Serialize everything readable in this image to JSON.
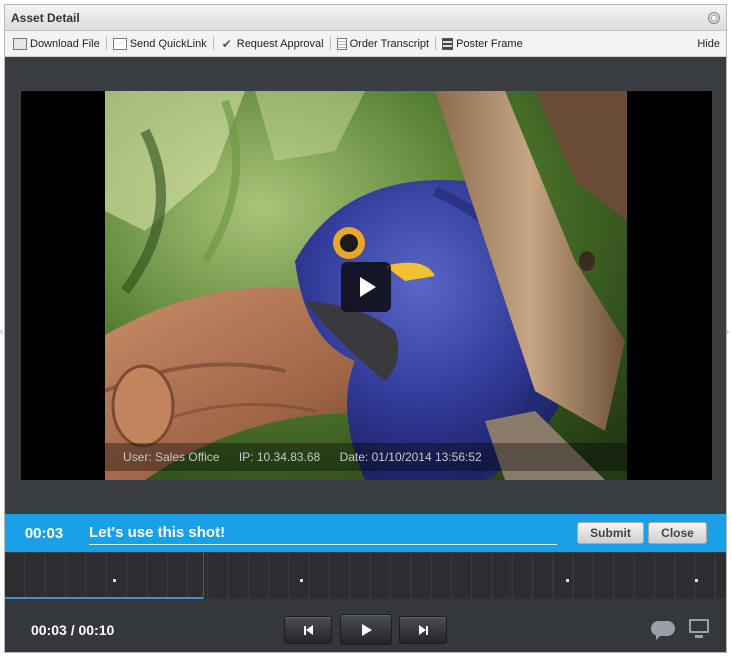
{
  "window": {
    "title": "Asset Detail"
  },
  "toolbar": {
    "items": [
      {
        "label": "Download File",
        "icon": "download-file-icon"
      },
      {
        "label": "Send QuickLink",
        "icon": "mail-icon"
      },
      {
        "label": "Request Approval",
        "icon": "checkmark-icon"
      },
      {
        "label": "Order Transcript",
        "icon": "document-icon"
      },
      {
        "label": "Poster Frame",
        "icon": "film-icon"
      }
    ],
    "hide_label": "Hide"
  },
  "video": {
    "user": "User: Sales Office",
    "ip": "IP: 10.34.83.68",
    "date": "Date: 01/10/2014 13:56:52"
  },
  "comment": {
    "time": "00:03",
    "text": "Let's use this shot!",
    "submit_label": "Submit",
    "close_label": "Close"
  },
  "timeline": {
    "progress_fraction": 0.3,
    "comment_markers_seconds": [
      1.5,
      4.1,
      7.8,
      9.6
    ],
    "duration_seconds": 10
  },
  "controls": {
    "time_display": "00:03 / 00:10"
  },
  "colors": {
    "accent": "#1aa0e6",
    "playhead": "#dd2222"
  }
}
